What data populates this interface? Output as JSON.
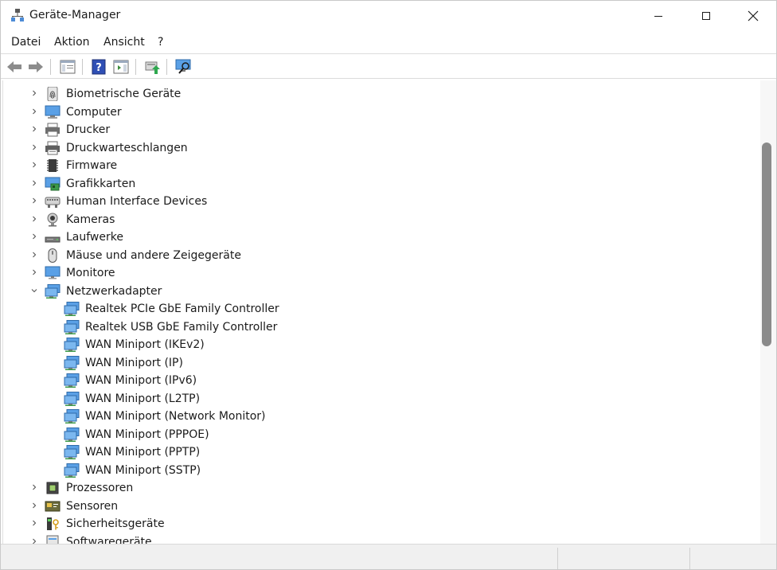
{
  "window": {
    "title": "Geräte-Manager"
  },
  "menu": [
    "Datei",
    "Aktion",
    "Ansicht",
    "?"
  ],
  "tree": [
    {
      "label": "Biometrische Geräte",
      "icon": "fingerprint-icon",
      "level": 0,
      "expanded": false
    },
    {
      "label": "Computer",
      "icon": "computer-icon",
      "level": 0,
      "expanded": false
    },
    {
      "label": "Drucker",
      "icon": "printer-icon",
      "level": 0,
      "expanded": false
    },
    {
      "label": "Druckwarteschlangen",
      "icon": "print-queue-icon",
      "level": 0,
      "expanded": false
    },
    {
      "label": "Firmware",
      "icon": "firmware-chip-icon",
      "level": 0,
      "expanded": false
    },
    {
      "label": "Grafikkarten",
      "icon": "display-adapter-icon",
      "level": 0,
      "expanded": false
    },
    {
      "label": "Human Interface Devices",
      "icon": "hid-icon",
      "level": 0,
      "expanded": false
    },
    {
      "label": "Kameras",
      "icon": "camera-icon",
      "level": 0,
      "expanded": false
    },
    {
      "label": "Laufwerke",
      "icon": "disk-drive-icon",
      "level": 0,
      "expanded": false
    },
    {
      "label": "Mäuse und andere Zeigegeräte",
      "icon": "mouse-icon",
      "level": 0,
      "expanded": false
    },
    {
      "label": "Monitore",
      "icon": "monitor-icon",
      "level": 0,
      "expanded": false
    },
    {
      "label": "Netzwerkadapter",
      "icon": "network-adapter-icon",
      "level": 0,
      "expanded": true
    },
    {
      "label": "Realtek PCIe GbE Family Controller",
      "icon": "network-adapter-icon",
      "level": 1
    },
    {
      "label": "Realtek USB GbE Family Controller",
      "icon": "network-adapter-icon",
      "level": 1
    },
    {
      "label": "WAN Miniport (IKEv2)",
      "icon": "network-adapter-icon",
      "level": 1
    },
    {
      "label": "WAN Miniport (IP)",
      "icon": "network-adapter-icon",
      "level": 1
    },
    {
      "label": "WAN Miniport (IPv6)",
      "icon": "network-adapter-icon",
      "level": 1
    },
    {
      "label": "WAN Miniport (L2TP)",
      "icon": "network-adapter-icon",
      "level": 1
    },
    {
      "label": "WAN Miniport (Network Monitor)",
      "icon": "network-adapter-icon",
      "level": 1
    },
    {
      "label": "WAN Miniport (PPPOE)",
      "icon": "network-adapter-icon",
      "level": 1
    },
    {
      "label": "WAN Miniport (PPTP)",
      "icon": "network-adapter-icon",
      "level": 1
    },
    {
      "label": "WAN Miniport (SSTP)",
      "icon": "network-adapter-icon",
      "level": 1
    },
    {
      "label": "Prozessoren",
      "icon": "processor-icon",
      "level": 0,
      "expanded": false
    },
    {
      "label": "Sensoren",
      "icon": "sensor-icon",
      "level": 0,
      "expanded": false
    },
    {
      "label": "Sicherheitsgeräte",
      "icon": "security-device-icon",
      "level": 0,
      "expanded": false
    },
    {
      "label": "Softwaregeräte",
      "icon": "software-device-icon",
      "level": 0,
      "expanded": false
    }
  ]
}
